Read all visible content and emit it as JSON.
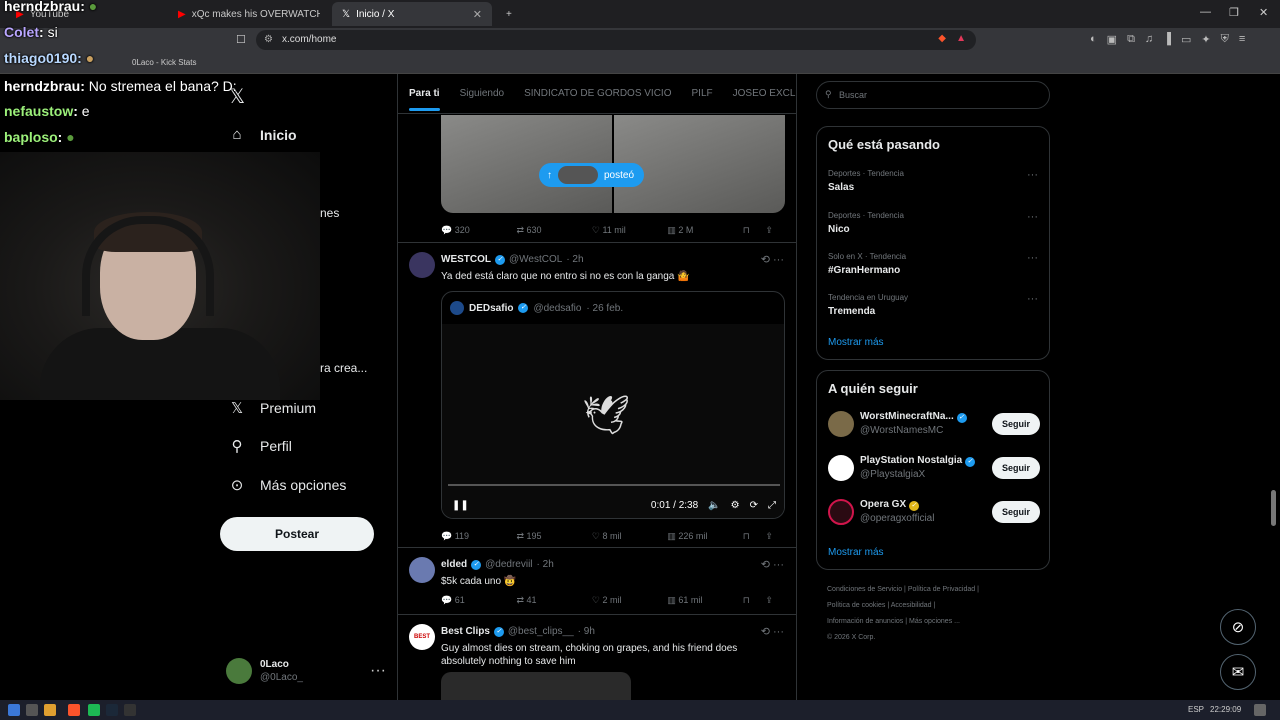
{
  "browser": {
    "tabs": [
      {
        "label": "YouTube",
        "active": false
      },
      {
        "label": "xQc makes his OVERWATCH LEAGUE",
        "active": false
      },
      {
        "label": "Inicio / X",
        "active": true
      }
    ],
    "url": "x.com/home",
    "bookmark_label": "0Laco - Kick Stats"
  },
  "nav": {
    "home": "Inicio",
    "partial_1": "nes",
    "partial_2": "ra crea...",
    "premium": "Premium",
    "profile": "Perfil",
    "more": "Más opciones",
    "post": "Postear",
    "account_name": "0Laco",
    "account_handle": "@0Laco_"
  },
  "feed": {
    "tabs": [
      "Para ti",
      "Siguiendo",
      "SINDICATO DE GORDOS VICIO",
      "PILF",
      "JOSEO EXCLUSI"
    ],
    "posted_pill": "posteó",
    "tweet1_stats": {
      "replies": "320",
      "retweets": "630",
      "likes": "11 mil",
      "views": "2 M"
    },
    "tweet2": {
      "name": "WESTCOL",
      "handle": "@WestCOL",
      "time": "· 2h",
      "text": "Ya ded está claro que no entro si no es con la ganga 🤷",
      "quote_name": "DEDsafio",
      "quote_handle": "@dedsafio",
      "quote_time": "· 26 feb.",
      "video_time": "0:01 / 2:38",
      "stats": {
        "replies": "119",
        "retweets": "195",
        "likes": "8 mil",
        "views": "226 mil"
      }
    },
    "tweet3": {
      "name": "elded",
      "handle": "@dedreviil",
      "time": "· 2h",
      "text": "$5k cada uno 🤠",
      "stats": {
        "replies": "61",
        "retweets": "41",
        "likes": "2 mil",
        "views": "61 mil"
      }
    },
    "tweet4": {
      "name": "Best Clips",
      "handle": "@best_clips__",
      "time": "· 9h",
      "text": "Guy almost dies on stream, choking on grapes, and his friend does absolutely nothing to save him",
      "avatar_text": "BEST"
    }
  },
  "sidebar": {
    "search_placeholder": "Buscar",
    "trending_title": "Qué está pasando",
    "trends": [
      {
        "context": "Deportes · Tendencia",
        "name": "Salas"
      },
      {
        "context": "Deportes · Tendencia",
        "name": "Nico"
      },
      {
        "context": "Solo en X · Tendencia",
        "name": "#GranHermano"
      },
      {
        "context": "Tendencia en Uruguay",
        "name": "Tremenda"
      }
    ],
    "show_more": "Mostrar más",
    "follow_title": "A quién seguir",
    "follow": [
      {
        "name": "WorstMinecraftNa...",
        "handle": "@WorstNamesMC",
        "button": "Seguir",
        "color": "#7a6a48"
      },
      {
        "name": "PlayStation Nostalgia",
        "handle": "@PlaystalgiaX",
        "button": "Seguir",
        "color": "#ffffff"
      },
      {
        "name": "Opera GX",
        "handle": "@operagxofficial",
        "button": "Seguir",
        "color": "#2a0a12"
      }
    ],
    "show_more_2": "Mostrar más",
    "footer": [
      "Condiciones de Servicio",
      "Política de Privacidad",
      "Política de cookies",
      "Accesibilidad",
      "Información de anuncios",
      "Más opciones ...",
      "© 2026 X Corp."
    ]
  },
  "overlay": {
    "chat": [
      {
        "user": "herndzbrau",
        "msg": "",
        "color": "#ffffff"
      },
      {
        "user": "Colet",
        "msg": "si",
        "color": "#b9a6ff"
      },
      {
        "user": "thiago0190",
        "msg": "",
        "color": "#b8d8ff"
      },
      {
        "user": "herndzbrau",
        "msg": "No stremea el bana? D:",
        "color": "#ffffff"
      },
      {
        "user": "nefaustow",
        "msg": "e",
        "color": "#9cf07a"
      },
      {
        "user": "baploso",
        "msg": "",
        "color": "#9cf07a"
      }
    ]
  },
  "taskbar": {
    "lang": "ESP",
    "time": "22:29:09"
  }
}
